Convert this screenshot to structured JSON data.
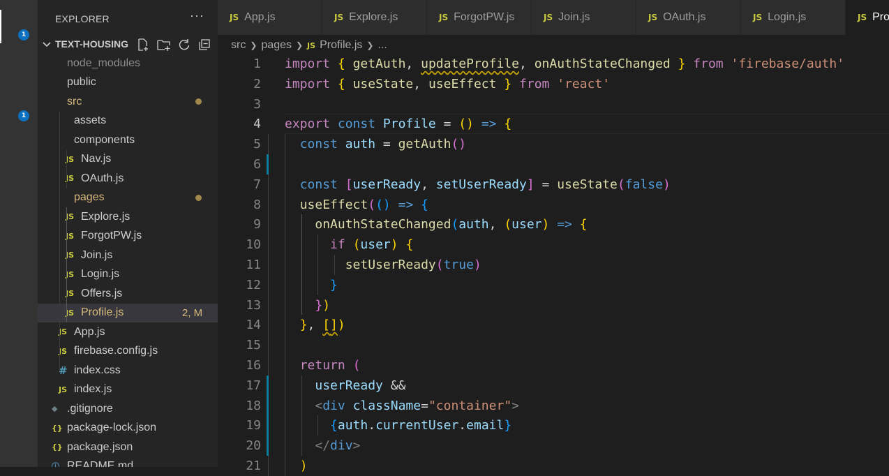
{
  "activity_bar": {
    "items": [
      {
        "icon": "files-icon",
        "badge": "1"
      },
      {
        "icon": "search-icon"
      },
      {
        "icon": "source-control-icon",
        "badge": "1"
      },
      {
        "icon": "run-debug-icon"
      },
      {
        "icon": "extensions-icon"
      },
      {
        "icon": "remote-explorer-icon"
      },
      {
        "icon": "docker-icon"
      },
      {
        "icon": "postgres-icon"
      }
    ]
  },
  "explorer": {
    "title": "EXPLORER",
    "more": "···",
    "project": "TEXT-HOUSING",
    "tree": [
      {
        "label": "node_modules",
        "type": "folder",
        "open": false,
        "depth": 0,
        "color": "#8c8c8c"
      },
      {
        "label": "public",
        "type": "folder",
        "open": false,
        "depth": 0
      },
      {
        "label": "src",
        "type": "folder",
        "open": true,
        "depth": 0,
        "color": "#d7ba7d",
        "modified_dot": true
      },
      {
        "label": "assets",
        "type": "folder",
        "open": false,
        "depth": 1
      },
      {
        "label": "components",
        "type": "folder",
        "open": true,
        "depth": 1
      },
      {
        "label": "Nav.js",
        "type": "js",
        "depth": 2
      },
      {
        "label": "OAuth.js",
        "type": "js",
        "depth": 2
      },
      {
        "label": "pages",
        "type": "folder",
        "open": true,
        "depth": 1,
        "color": "#d7ba7d",
        "modified_dot": true
      },
      {
        "label": "Explore.js",
        "type": "js",
        "depth": 2
      },
      {
        "label": "ForgotPW.js",
        "type": "js",
        "depth": 2
      },
      {
        "label": "Join.js",
        "type": "js",
        "depth": 2
      },
      {
        "label": "Login.js",
        "type": "js",
        "depth": 2
      },
      {
        "label": "Offers.js",
        "type": "js",
        "depth": 2
      },
      {
        "label": "Profile.js",
        "type": "js",
        "depth": 2,
        "selected": true,
        "color": "#d7ba7d",
        "status": "2, M"
      },
      {
        "label": "App.js",
        "type": "js",
        "depth": 1
      },
      {
        "label": "firebase.config.js",
        "type": "js",
        "depth": 1
      },
      {
        "label": "index.css",
        "type": "css",
        "depth": 1
      },
      {
        "label": "index.js",
        "type": "js",
        "depth": 1
      },
      {
        "label": ".gitignore",
        "type": "git",
        "depth": 0
      },
      {
        "label": "package-lock.json",
        "type": "json",
        "depth": 0
      },
      {
        "label": "package.json",
        "type": "json",
        "depth": 0
      },
      {
        "label": "README.md",
        "type": "info",
        "depth": 0
      }
    ]
  },
  "tabs": [
    "App.js",
    "Explore.js",
    "ForgotPW.js",
    "Join.js",
    "OAuth.js",
    "Login.js",
    "Profile.js"
  ],
  "breadcrumbs": [
    "src",
    "pages",
    "Profile.js",
    "..."
  ],
  "editor": {
    "current_line": 4,
    "lines": [
      {
        "n": "1",
        "text": "import { getAuth, updateProfile, onAuthStateChanged } from 'firebase/auth'"
      },
      {
        "n": "2",
        "text": "import { useState, useEffect } from 'react'"
      },
      {
        "n": "3",
        "text": ""
      },
      {
        "n": "4",
        "text": "export const Profile = () => {"
      },
      {
        "n": "5",
        "text": "  const auth = getAuth()"
      },
      {
        "n": "6",
        "text": ""
      },
      {
        "n": "7",
        "text": "  const [userReady, setUserReady] = useState(false)"
      },
      {
        "n": "8",
        "text": "  useEffect(() => {"
      },
      {
        "n": "9",
        "text": "    onAuthStateChanged(auth, (user) => {"
      },
      {
        "n": "10",
        "text": "      if (user) {"
      },
      {
        "n": "11",
        "text": "        setUserReady(true)"
      },
      {
        "n": "12",
        "text": "      }"
      },
      {
        "n": "13",
        "text": "    })"
      },
      {
        "n": "14",
        "text": "  }, [])"
      },
      {
        "n": "15",
        "text": ""
      },
      {
        "n": "16",
        "text": "  return ("
      },
      {
        "n": "17",
        "text": "    userReady &&"
      },
      {
        "n": "18",
        "text": "    <div className=\"container\">"
      },
      {
        "n": "19",
        "text": "      {auth.currentUser.email}"
      },
      {
        "n": "20",
        "text": "    </div>"
      },
      {
        "n": "21",
        "text": "  )"
      }
    ]
  },
  "colors": {
    "activity_bar": "#333333",
    "sidebar": "#252526",
    "editor": "#1e1e1e",
    "badge": "#0e70c0",
    "js_icon": "#cbcb41",
    "modified": "#d7ba7d"
  }
}
